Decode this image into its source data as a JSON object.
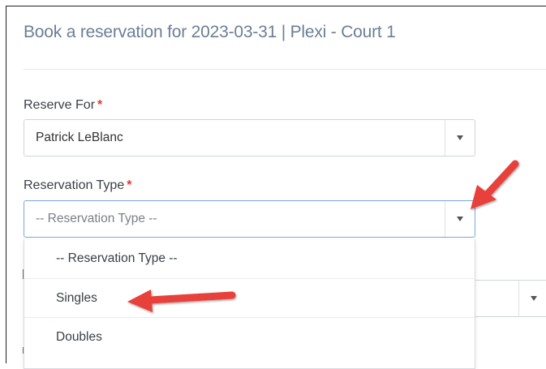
{
  "header": {
    "title": "Book a reservation for 2023-03-31 | Plexi - Court 1"
  },
  "form": {
    "reserve_for": {
      "label": "Reserve For",
      "required_mark": "*",
      "value": "Patrick LeBlanc"
    },
    "reservation_type": {
      "label": "Reservation Type",
      "required_mark": "*",
      "value": "-- Reservation Type --",
      "options": [
        "-- Reservation Type --",
        "Singles",
        "Doubles"
      ]
    }
  },
  "annotation": {
    "arrow_color": "#e8403a"
  },
  "icons": {
    "dropdown": "caret-down-icon"
  }
}
